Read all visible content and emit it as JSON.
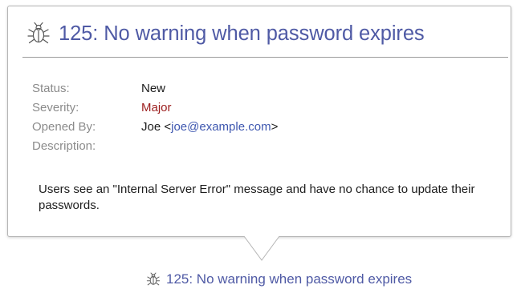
{
  "popover": {
    "icon": "bug-icon",
    "title": "125: No warning when password expires",
    "fields": {
      "status_label": "Status:",
      "status_value": "New",
      "severity_label": "Severity:",
      "severity_value": "Major",
      "opened_by_label": "Opened By:",
      "opened_by_name": "Joe <",
      "opened_by_email": "joe@example.com",
      "opened_by_suffix": ">",
      "description_label": "Description:"
    },
    "description": "Users see an \"Internal Server Error\" message and have no chance to update their passwords."
  },
  "link": {
    "icon": "bug-icon",
    "title": "125: No warning when password expires"
  },
  "colors": {
    "title": "#4f5aa5",
    "label": "#8b8b8b",
    "severity": "#9b1c1c",
    "email": "#3f58b0"
  }
}
